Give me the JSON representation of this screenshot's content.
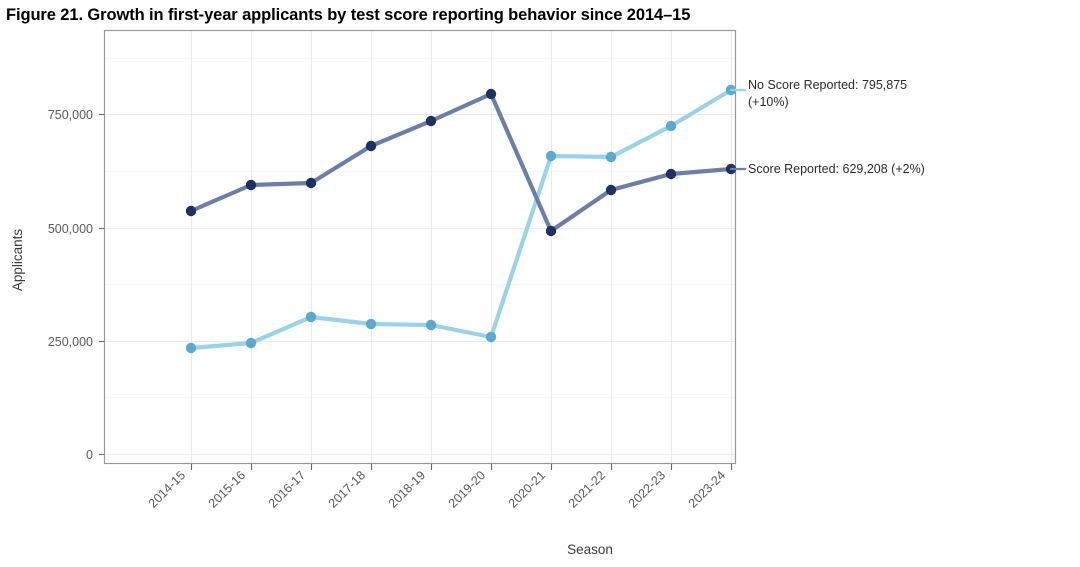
{
  "figure": {
    "title": "Figure 21. Growth in first-year applicants by test score reporting behavior since 2014–15"
  },
  "chart_data": {
    "type": "line",
    "title": "Figure 21. Growth in first-year applicants by test score reporting behavior since 2014–15",
    "xlabel": "Season",
    "ylabel": "Applicants",
    "categories": [
      "2014-15",
      "2015-16",
      "2016-17",
      "2017-18",
      "2018-19",
      "2019-20",
      "2020-21",
      "2021-22",
      "2022-23",
      "2023-24"
    ],
    "ylim": [
      0,
      880000
    ],
    "yticks": [
      0,
      250000,
      500000,
      750000
    ],
    "ytick_labels": [
      "0",
      "250,000",
      "500,000",
      "750,000"
    ],
    "minor_gridlines": [
      125000,
      375000,
      625000,
      875000
    ],
    "grid": true,
    "legend_position": "inline-annotation",
    "series": [
      {
        "name": "Score Reported",
        "color": "#6d7fa8",
        "marker_color": "#1f3160",
        "values": [
          536000,
          594000,
          599000,
          679000,
          735000,
          795000,
          493000,
          583000,
          617000,
          629208
        ],
        "end_label": "Score Reported: 629,208 (+2%)",
        "end_value": 629208,
        "growth": "+2%"
      },
      {
        "name": "No Score Reported",
        "color": "#9ad2e8",
        "marker_color": "#5ba9cf",
        "values": [
          234000,
          246000,
          302000,
          287000,
          285000,
          259000,
          658000,
          655000,
          723000,
          795875
        ],
        "end_label": "No Score Reported: 795,875",
        "end_label_line2": "(+10%)",
        "end_value": 795875,
        "growth": "+10%"
      }
    ],
    "annotations": [
      {
        "id": "no-score-reported",
        "line1": "No Score Reported: 795,875",
        "line2": "(+10%)"
      },
      {
        "id": "score-reported",
        "line1": "Score Reported: 629,208 (+2%)",
        "line2": ""
      }
    ],
    "colors": {
      "no_score_line": "#9ad2e8",
      "no_score_marker": "#5ba9cf",
      "score_line": "#6d7fa8",
      "score_marker": "#1f3160",
      "grid_major": "#ebebeb",
      "grid_minor": "#f4f4f4",
      "panel_border": "#9a9a9a",
      "axis_text": "#5a5a5a"
    }
  }
}
